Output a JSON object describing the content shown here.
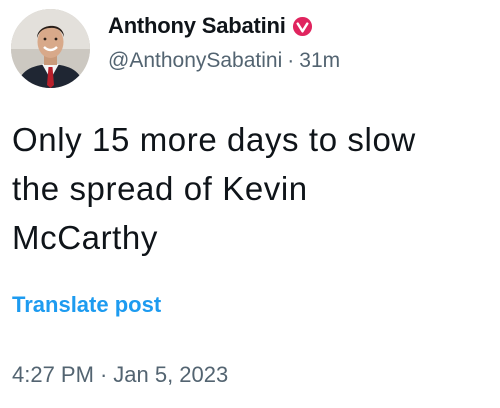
{
  "post": {
    "author": {
      "display_name": "Anthony Sabatini",
      "handle": "@AnthonySabatini",
      "relative_time": "31m",
      "separator": "·",
      "verified_badge_icon": "verified-badge-icon",
      "badge_color": "#e0245e",
      "avatar_icon": "profile-photo"
    },
    "text_lines": [
      "Only 15 more days to slow",
      "the spread of Kevin",
      "McCarthy"
    ],
    "translate_label": "Translate post",
    "timestamp": {
      "time": "4:27 PM",
      "separator": "·",
      "date": "Jan 5, 2023"
    }
  },
  "colors": {
    "link": "#1d9bf0",
    "secondary_text": "#536471",
    "primary_text": "#0f1419"
  }
}
